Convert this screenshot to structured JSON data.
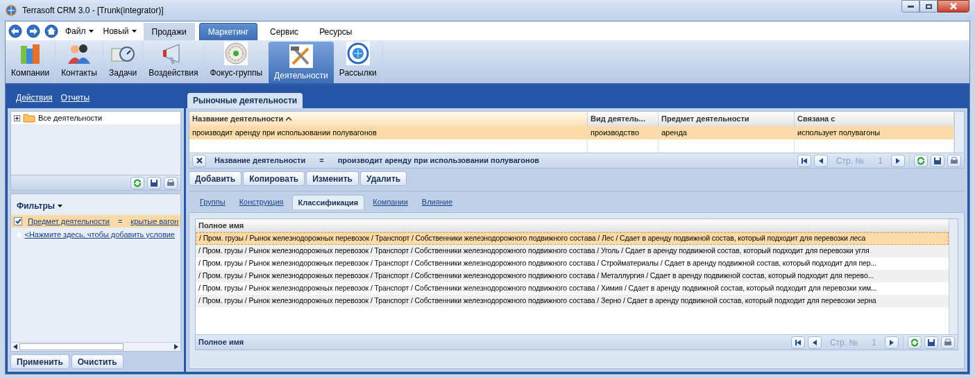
{
  "window": {
    "title": "Terrasoft CRM 3.0 - [Trunk(integrator)]"
  },
  "menus": [
    {
      "label": "Файл",
      "dropdown": true
    },
    {
      "label": "Новый",
      "dropdown": true
    }
  ],
  "tabs": [
    {
      "label": "Продажи",
      "selected": false
    },
    {
      "label": "Маркетинг",
      "selected": true
    },
    {
      "label": "Сервис",
      "selected": false
    },
    {
      "label": "Ресурсы",
      "selected": false
    }
  ],
  "ribbon": [
    {
      "label": "Компании",
      "kind": "buildings",
      "selected": false
    },
    {
      "label": "Контакты",
      "kind": "people",
      "selected": false
    },
    {
      "label": "Задачи",
      "kind": "stopwatch",
      "selected": false
    },
    {
      "label": "Воздействия",
      "kind": "megaphone",
      "selected": false
    },
    {
      "label": "Фокус-группы",
      "kind": "target",
      "selected": false
    },
    {
      "label": "Деятельности",
      "kind": "tools",
      "selected": true
    },
    {
      "label": "Рассылки",
      "kind": "globe",
      "selected": false
    }
  ],
  "left": {
    "links": [
      "Действия",
      "Отчеты"
    ],
    "tree": [
      {
        "label": "Все деятельности",
        "expanded": false
      }
    ],
    "filters_title": "Фильтры",
    "conditions": [
      {
        "checked": true,
        "field": "Предмет деятельности",
        "op": "=",
        "value": "крытые вагон"
      }
    ],
    "add_condition": "<Нажмите здесь, чтобы добавить условие",
    "buttons": [
      "Применить",
      "Очистить"
    ]
  },
  "panel_tab": "Рыночные деятельности",
  "grid": {
    "columns": [
      {
        "label": "Название деятельности",
        "sorted": true
      },
      {
        "label": "Вид деятель...",
        "sorted": false
      },
      {
        "label": "Предмет деятельности",
        "sorted": false
      },
      {
        "label": "Связана с",
        "sorted": false
      }
    ],
    "rows": [
      {
        "selected": true,
        "cells": [
          "производит аренду при использовании полувагонов",
          "производство",
          "аренда",
          "использует полувагоны"
        ]
      }
    ],
    "filter": {
      "field": "Название деятельности",
      "op": "=",
      "value": "производит аренду при использовании полувагонов"
    },
    "pager": {
      "label": "Стр. №",
      "page": "1"
    }
  },
  "actions": [
    "Добавить",
    "Копировать",
    "Изменить",
    "Удалить"
  ],
  "detail_tabs": [
    {
      "label": "Группы",
      "selected": false
    },
    {
      "label": "Конструкция",
      "selected": false
    },
    {
      "label": "Классификация",
      "selected": true
    },
    {
      "label": "Компании",
      "selected": false
    },
    {
      "label": "Влияние",
      "selected": false
    }
  ],
  "detail": {
    "column": "Полное имя",
    "rows": [
      {
        "selected": true,
        "text": "/ Пром. грузы / Рынок железнодорожных перевозок / Транспорт / Собственники железнодорожного подвижного состава / Лес / Сдает в аренду подвижной состав, который подходит для перевозки леса"
      },
      {
        "selected": false,
        "text": "/ Пром. грузы / Рынок железнодорожных перевозок / Транспорт / Собственники железнодорожного подвижного состава / Уголь / Сдает в аренду подвижной состав, который подходит для перевозки угля"
      },
      {
        "selected": false,
        "text": "/ Пром. грузы / Рынок железнодорожных перевозок / Транспорт / Собственники железнодорожного подвижного состава / Стройматериалы / Сдает в аренду подвижной состав, который подходит для пер..."
      },
      {
        "selected": false,
        "text": "/ Пром. грузы / Рынок железнодорожных перевозок / Транспорт / Собственники железнодорожного подвижного состава / Металлургия / Сдает в аренду подвижной состав, который подходит для перево..."
      },
      {
        "selected": false,
        "text": "/ Пром. грузы / Рынок железнодорожных перевозок / Транспорт / Собственники железнодорожного подвижного состава / Химия / Сдает в аренду подвижной состав, который подходит для перевозки хим..."
      },
      {
        "selected": false,
        "text": "/ Пром. грузы / Рынок железнодорожных перевозок / Транспорт / Собственники железнодорожного подвижного состава / Зерно / Сдает в аренду подвижной состав, который подходит для перевозки зерна"
      }
    ],
    "footer": "Полное имя",
    "pager": {
      "label": "Стр. №",
      "page": "1"
    }
  }
}
